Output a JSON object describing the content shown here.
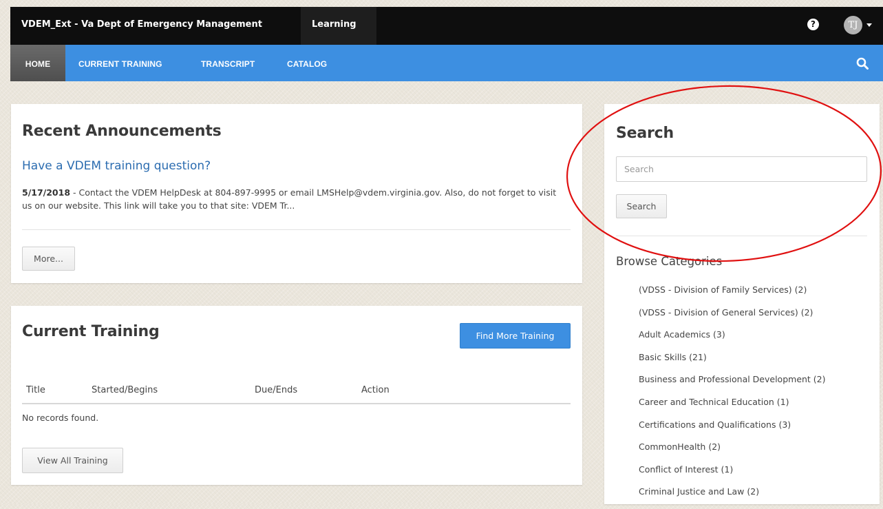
{
  "header": {
    "brand": "VDEM_Ext - Va Dept of Emergency Management",
    "module_tab": "Learning",
    "help_glyph": "?",
    "user_initials": "TJ"
  },
  "nav": {
    "items": [
      {
        "label": "HOME",
        "active": true
      },
      {
        "label": "CURRENT TRAINING",
        "active": false
      },
      {
        "label": "TRANSCRIPT",
        "active": false
      },
      {
        "label": "CATALOG",
        "active": false
      }
    ]
  },
  "announcements": {
    "title": "Recent Announcements",
    "headline": "Have a VDEM training question?",
    "date": "5/17/2018",
    "body": " - Contact the VDEM HelpDesk at 804-897-9995 or email LMSHelp@vdem.virginia.gov.  Also, do not forget to visit us on our website.  This link will take you to that site:  VDEM Tr...",
    "more_label": "More..."
  },
  "training": {
    "title": "Current Training",
    "find_more_label": "Find More Training",
    "columns": [
      "Title",
      "Started/Begins",
      "Due/Ends",
      "Action"
    ],
    "empty_text": "No records found.",
    "view_all_label": "View All Training"
  },
  "search": {
    "title": "Search",
    "placeholder": "Search",
    "button_label": "Search",
    "browse_title": "Browse Categories",
    "categories": [
      "(VDSS - Division of Family Services) (2)",
      "(VDSS - Division of General Services) (2)",
      "Adult Academics (3)",
      "Basic Skills (21)",
      "Business and Professional Development (2)",
      "Career and Technical Education (1)",
      "Certifications and Qualifications (3)",
      "CommonHealth (2)",
      "Conflict of Interest (1)",
      "Criminal Justice and Law (2)"
    ]
  },
  "colors": {
    "topbar": "#0e0e0e",
    "nav": "#3d8fe1",
    "link": "#2b6cb0",
    "annotation": "#e01010"
  }
}
